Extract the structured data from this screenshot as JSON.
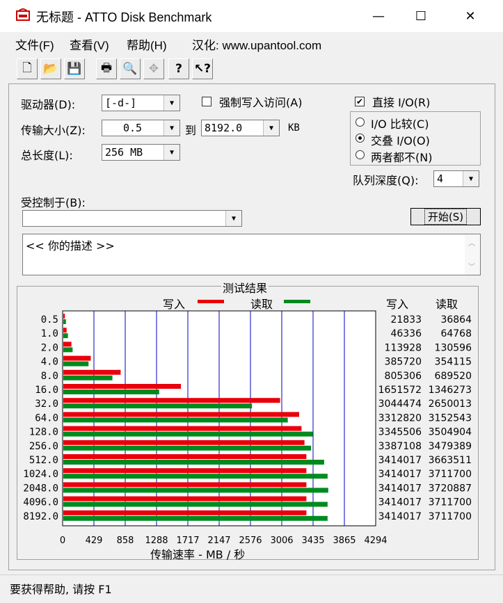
{
  "window": {
    "title": "无标题 - ATTO Disk Benchmark",
    "minimize": "—",
    "maximize": "☐",
    "close": "✕"
  },
  "menu": [
    "文件(F)",
    "查看(V)",
    "帮助(H)",
    "汉化: www.upantool.com"
  ],
  "toolbar": [
    {
      "name": "new-icon",
      "glyph": "🗋"
    },
    {
      "name": "open-icon",
      "glyph": "📂"
    },
    {
      "name": "save-icon",
      "glyph": "💾"
    },
    {
      "name": "print-icon",
      "glyph": "🖶"
    },
    {
      "name": "print-preview-icon",
      "glyph": "🔍"
    },
    {
      "name": "move-icon",
      "glyph": "✥"
    },
    {
      "name": "help-icon",
      "glyph": "?"
    },
    {
      "name": "context-help-icon",
      "glyph": "↖?"
    }
  ],
  "form": {
    "drive_label": "驱动器(D):",
    "drive_value": "[-d-]",
    "force_write_label": "强制写入访问(A)",
    "direct_io_label": "直接 I/O(R)",
    "transfer_label": "传输大小(Z):",
    "transfer_from": "0.5",
    "to_label": "到",
    "transfer_to": "8192.0",
    "kb_unit": "KB",
    "length_label": "总长度(L):",
    "length_value": "256 MB",
    "io_compare": "I/O 比较(C)",
    "overlapped": "交叠 I/O(O)",
    "neither": "两者都不(N)",
    "queue_label": "队列深度(Q):",
    "queue_value": "4",
    "controlled_label": "受控制于(B):",
    "controlled_value": "",
    "start_button": "开始(S)",
    "description": "<<  你的描述   >>"
  },
  "results": {
    "group_title": "测试结果",
    "legend_write": "写入",
    "legend_read": "读取",
    "col_write": "写入",
    "col_read": "读取",
    "xlabel": "传输速率 - MB / 秒"
  },
  "colors": {
    "write": "#e8000b",
    "read": "#008a1e",
    "grid": "#0000c0"
  },
  "chart_data": {
    "type": "bar",
    "categories": [
      "0.5",
      "1.0",
      "2.0",
      "4.0",
      "8.0",
      "16.0",
      "32.0",
      "64.0",
      "128.0",
      "256.0",
      "512.0",
      "1024.0",
      "2048.0",
      "4096.0",
      "8192.0"
    ],
    "series": [
      {
        "name": "写入",
        "values": [
          21833,
          46336,
          113928,
          385720,
          805306,
          1651572,
          3044474,
          3312820,
          3345506,
          3387108,
          3414017,
          3414017,
          3414017,
          3414017,
          3414017
        ]
      },
      {
        "name": "读取",
        "values": [
          36864,
          64768,
          130596,
          354115,
          689520,
          1346273,
          2650013,
          3152543,
          3504904,
          3479389,
          3663511,
          3711700,
          3720887,
          3711700,
          3711700
        ]
      }
    ],
    "xticks": [
      "0",
      "429",
      "858",
      "1288",
      "1717",
      "2147",
      "2576",
      "3006",
      "3435",
      "3865",
      "4294"
    ],
    "xlim": [
      0,
      4294
    ],
    "xlabel": "传输速率 - MB / 秒"
  },
  "status": {
    "text": "要获得帮助, 请按 F1"
  }
}
